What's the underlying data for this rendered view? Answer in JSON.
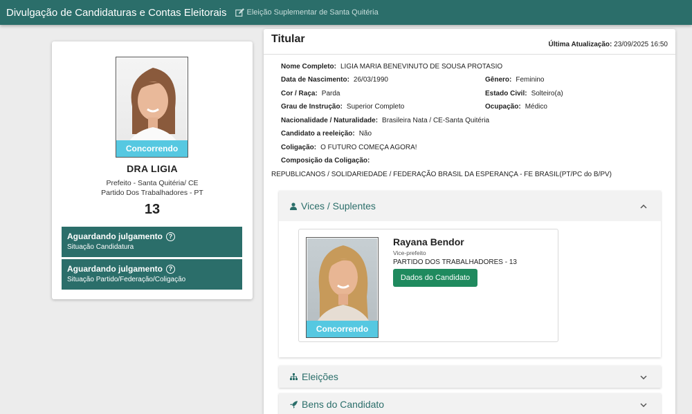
{
  "topbar": {
    "title": "Divulgação de Candidaturas e Contas Eleitorais",
    "election": "Eleição Suplementar de Santa Quitéria"
  },
  "candidate": {
    "status_badge": "Concorrendo",
    "name": "DRA LIGIA",
    "office": "Prefeito - Santa Quitéria/ CE",
    "party": "Partido Dos Trabalhadores - PT",
    "number": "13",
    "status_boxes": [
      {
        "title": "Aguardando julgamento",
        "subtitle": "Situação Candidatura"
      },
      {
        "title": "Aguardando julgamento",
        "subtitle": "Situação Partido/Federação/Coligação"
      }
    ]
  },
  "titular": {
    "heading": "Titular",
    "update_label": "Última Atualização:",
    "update_value": "23/09/2025 16:50",
    "fields": {
      "full_name": {
        "label": "Nome Completo:",
        "value": "LIGIA MARIA BENEVINUTO DE SOUSA PROTASIO"
      },
      "birth_date": {
        "label": "Data de Nascimento:",
        "value": "26/03/1990"
      },
      "gender": {
        "label": "Gênero:",
        "value": "Feminino"
      },
      "race": {
        "label": "Cor / Raça:",
        "value": "Parda"
      },
      "marital": {
        "label": "Estado Civil:",
        "value": "Solteiro(a)"
      },
      "education": {
        "label": "Grau de Instrução:",
        "value": "Superior Completo"
      },
      "occupation": {
        "label": "Ocupação:",
        "value": "Médico"
      },
      "nationality": {
        "label": "Nacionalidade / Naturalidade:",
        "value": "Brasileira Nata / CE-Santa Quitéria"
      },
      "reelection": {
        "label": "Candidato a reeleição:",
        "value": "Não"
      },
      "coalition": {
        "label": "Coligação:",
        "value": "O FUTURO COMEÇA AGORA!"
      },
      "composition": {
        "label": "Composição da Coligação:",
        "value": ""
      }
    },
    "coalition_composition": "REPUBLICANOS / SOLIDARIEDADE / FEDERAÇÃO BRASIL DA ESPERANÇA - FE BRASIL(PT/PC do B/PV)"
  },
  "accordions": {
    "vices": {
      "title": "Vices / Suplentes",
      "icon": "person-icon",
      "expanded": true,
      "vice": {
        "status_badge": "Concorrendo",
        "name": "Rayana Bendor",
        "role": "Vice-prefeito",
        "party": "PARTIDO DOS TRABALHADORES - 13",
        "button": "Dados do Candidato"
      }
    },
    "elections": {
      "title": "Eleições",
      "icon": "sitemap-icon",
      "expanded": false
    },
    "assets": {
      "title": "Bens do Candidato",
      "icon": "rocket-icon",
      "expanded": false
    }
  },
  "colors": {
    "primary": "#2b6e6a",
    "badge": "#56c8e1",
    "button": "#1f8a5e"
  }
}
